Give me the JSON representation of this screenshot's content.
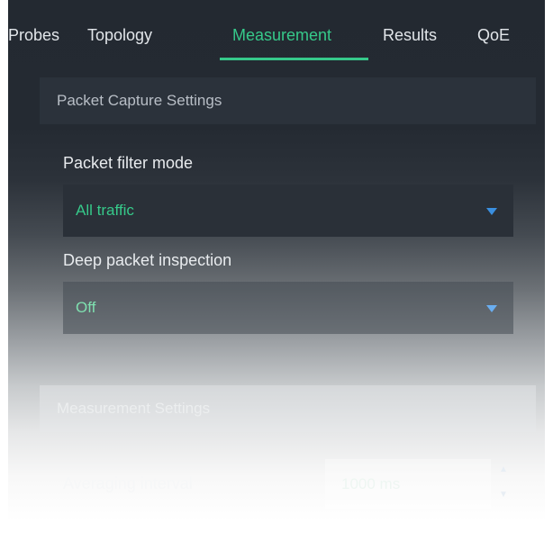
{
  "tabs": [
    {
      "label": "Probes"
    },
    {
      "label": "Topology"
    },
    {
      "label": "Measurement"
    },
    {
      "label": "Results"
    },
    {
      "label": "QoE"
    }
  ],
  "active_tab": "Measurement",
  "packet_capture": {
    "header": "Packet Capture Settings",
    "filter_mode": {
      "label": "Packet filter mode",
      "value": "All traffic"
    },
    "dpi": {
      "label": "Deep packet inspection",
      "value": "Off"
    }
  },
  "measurement": {
    "header": "Measurement Settings",
    "averaging_interval": {
      "label": "Averaging interval",
      "value": "1000 ms"
    }
  },
  "icons": {
    "dropdown": "dropdown-arrow-icon",
    "spin_up": "spin-up-icon",
    "spin_down": "spin-down-icon"
  },
  "colors": {
    "accent": "#36c98a",
    "arrow": "#3a8fe0",
    "background": "#232931"
  }
}
